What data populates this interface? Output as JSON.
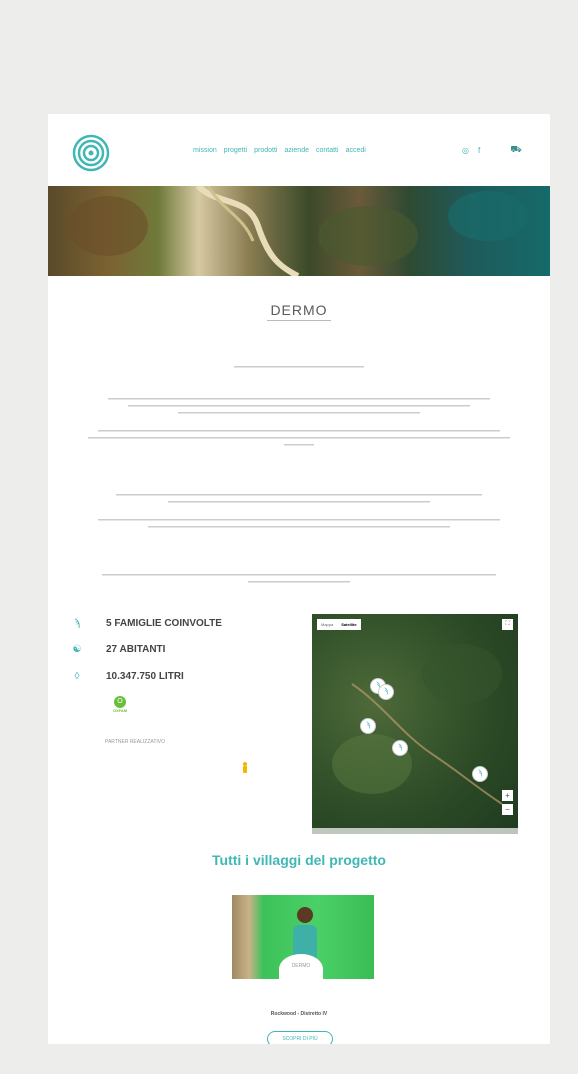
{
  "nav": {
    "items": [
      "mission",
      "progetti",
      "prodotti",
      "aziende",
      "contatti",
      "accedi"
    ],
    "instagram_icon": "instagram-icon",
    "facebook_icon": "facebook-icon",
    "cart_icon": "cart-icon"
  },
  "brand": {
    "title": "DERMO",
    "accent": "#3fb7b5",
    "partner_color": "#6abf3a"
  },
  "stats": [
    {
      "icon": "family-icon",
      "label": "5 FAMIGLIE COINVOLTE"
    },
    {
      "icon": "people-icon",
      "label": "27 ABITANTI"
    },
    {
      "icon": "water-drop-icon",
      "label": "10.347.750 LITRI"
    }
  ],
  "partner": {
    "logo_text": "OXFAM",
    "label": "PARTNER REALIZZATIVO"
  },
  "map": {
    "tab_map": "Mappa",
    "tab_satellite": "Satellite"
  },
  "villages": {
    "title": "Tutti i villaggi del progetto",
    "badge": "DERMO",
    "name": "Rockwood - Distretto IV",
    "button": "SCOPRI DI PIÙ"
  }
}
